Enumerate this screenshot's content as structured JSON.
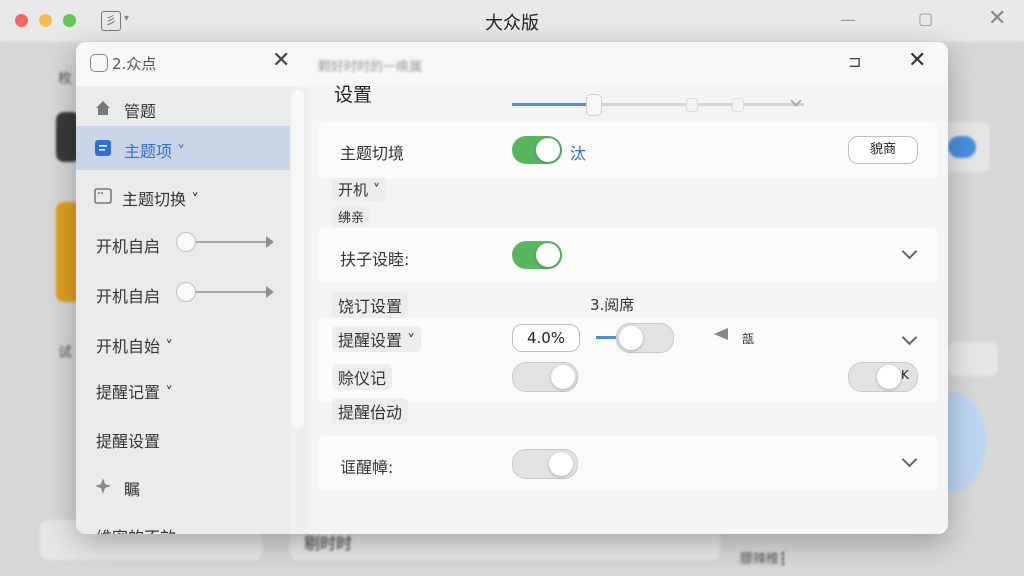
{
  "window": {
    "title": "大众版",
    "traffic_colors": {
      "close": "#ee6a5f",
      "minimize": "#f5be4f",
      "zoom": "#61c554"
    }
  },
  "background": {
    "side_labels": [
      "枚",
      "试"
    ],
    "footer_text": "剔时时",
    "footer_right": "膘辣椎┇"
  },
  "dialog": {
    "sidebar": {
      "title": "2.众点",
      "items": [
        {
          "label": "管题",
          "icon": "home-icon"
        },
        {
          "label": "主题项 ˅",
          "icon": "list-icon",
          "active": true
        },
        {
          "label": "主题切换 ˅",
          "icon": "window-icon"
        },
        {
          "label": "开机自启",
          "control": "slider"
        },
        {
          "label": "开机自启",
          "control": "slider"
        },
        {
          "label": "开机自始 ˅"
        },
        {
          "label": "提醒记置 ˅"
        },
        {
          "label": "提醒设置"
        },
        {
          "label": "瞩",
          "icon": "sparkle-icon"
        },
        {
          "label": "维密的不效"
        }
      ]
    },
    "main": {
      "header_title": "颗好时时的一唤属",
      "title": "设置",
      "rows": {
        "theme": {
          "label": "主题切境",
          "toggle": true,
          "toggle_text": "汰",
          "button": "貌商"
        },
        "boot_pill": "开机 ˅",
        "end_pill": "绋亲",
        "child": {
          "label": "扶子设睦:",
          "toggle": true
        },
        "lamp_pill": "饶订设置",
        "lamp_value": "3.阅席",
        "reminder": {
          "label": "提醒设置 ˅",
          "input_value": "4.0%",
          "volume_text": "瓿"
        },
        "instrument": {
          "label": "赊仪记",
          "toggle": false,
          "right_key": "K"
        },
        "reminder_start": "提醒佁动",
        "reminder_bell": {
          "label": "诓醒幛:",
          "toggle": false
        }
      }
    }
  },
  "colors": {
    "accent": "#4a90e2",
    "toggle_on": "#58b65f",
    "active_item": "#c8d5e6"
  }
}
